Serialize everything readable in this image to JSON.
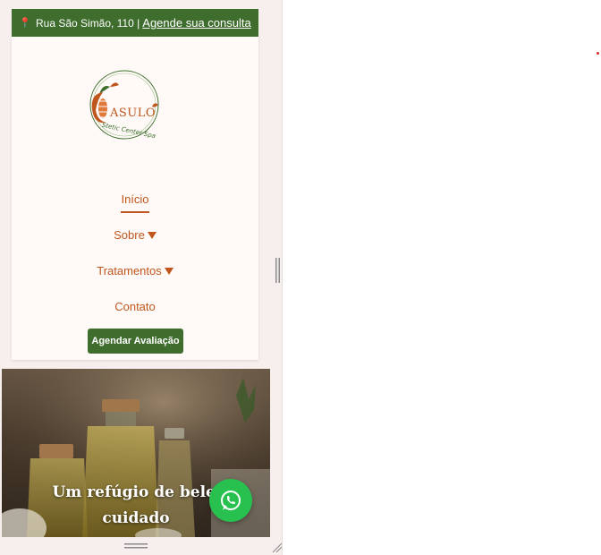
{
  "topbar": {
    "address": "Rua São Simão, 110 |",
    "cta_link": "Agende sua consulta",
    "pin_icon": "map-pin-icon"
  },
  "logo": {
    "brand_text": "CASULO",
    "tagline": "Stetic Center Spa"
  },
  "nav": {
    "items": [
      {
        "label": "Início",
        "active": true,
        "dropdown": false
      },
      {
        "label": "Sobre",
        "active": false,
        "dropdown": true
      },
      {
        "label": "Tratamentos",
        "active": false,
        "dropdown": true
      },
      {
        "label": "Contato",
        "active": false,
        "dropdown": false
      }
    ],
    "cta_label": "Agendar Avaliação"
  },
  "hero": {
    "title_line1": "Um refúgio de beleza",
    "title_line2": "cuidado"
  },
  "whatsapp": {
    "icon": "whatsapp-icon"
  },
  "colors": {
    "primary_green": "#3f6d2e",
    "accent_orange": "#c0561d",
    "header_bg": "#fffaf8",
    "whatsapp_green": "#28c150"
  }
}
